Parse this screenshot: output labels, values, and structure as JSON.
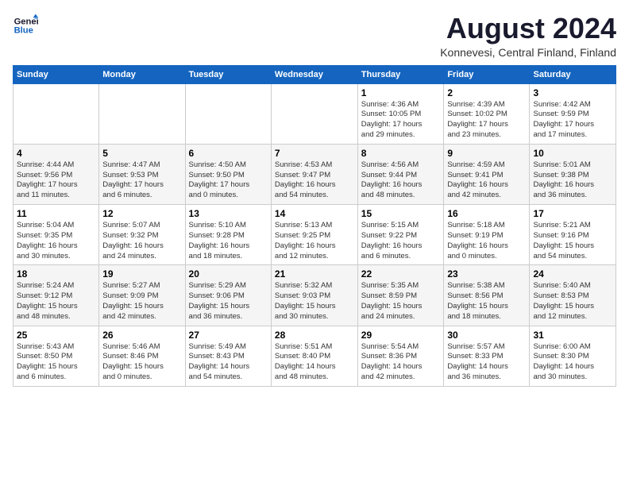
{
  "header": {
    "logo_line1": "General",
    "logo_line2": "Blue",
    "month_title": "August 2024",
    "location": "Konnevesi, Central Finland, Finland"
  },
  "weekdays": [
    "Sunday",
    "Monday",
    "Tuesday",
    "Wednesday",
    "Thursday",
    "Friday",
    "Saturday"
  ],
  "weeks": [
    [
      {
        "day": "",
        "info": ""
      },
      {
        "day": "",
        "info": ""
      },
      {
        "day": "",
        "info": ""
      },
      {
        "day": "",
        "info": ""
      },
      {
        "day": "1",
        "info": "Sunrise: 4:36 AM\nSunset: 10:05 PM\nDaylight: 17 hours\nand 29 minutes."
      },
      {
        "day": "2",
        "info": "Sunrise: 4:39 AM\nSunset: 10:02 PM\nDaylight: 17 hours\nand 23 minutes."
      },
      {
        "day": "3",
        "info": "Sunrise: 4:42 AM\nSunset: 9:59 PM\nDaylight: 17 hours\nand 17 minutes."
      }
    ],
    [
      {
        "day": "4",
        "info": "Sunrise: 4:44 AM\nSunset: 9:56 PM\nDaylight: 17 hours\nand 11 minutes."
      },
      {
        "day": "5",
        "info": "Sunrise: 4:47 AM\nSunset: 9:53 PM\nDaylight: 17 hours\nand 6 minutes."
      },
      {
        "day": "6",
        "info": "Sunrise: 4:50 AM\nSunset: 9:50 PM\nDaylight: 17 hours\nand 0 minutes."
      },
      {
        "day": "7",
        "info": "Sunrise: 4:53 AM\nSunset: 9:47 PM\nDaylight: 16 hours\nand 54 minutes."
      },
      {
        "day": "8",
        "info": "Sunrise: 4:56 AM\nSunset: 9:44 PM\nDaylight: 16 hours\nand 48 minutes."
      },
      {
        "day": "9",
        "info": "Sunrise: 4:59 AM\nSunset: 9:41 PM\nDaylight: 16 hours\nand 42 minutes."
      },
      {
        "day": "10",
        "info": "Sunrise: 5:01 AM\nSunset: 9:38 PM\nDaylight: 16 hours\nand 36 minutes."
      }
    ],
    [
      {
        "day": "11",
        "info": "Sunrise: 5:04 AM\nSunset: 9:35 PM\nDaylight: 16 hours\nand 30 minutes."
      },
      {
        "day": "12",
        "info": "Sunrise: 5:07 AM\nSunset: 9:32 PM\nDaylight: 16 hours\nand 24 minutes."
      },
      {
        "day": "13",
        "info": "Sunrise: 5:10 AM\nSunset: 9:28 PM\nDaylight: 16 hours\nand 18 minutes."
      },
      {
        "day": "14",
        "info": "Sunrise: 5:13 AM\nSunset: 9:25 PM\nDaylight: 16 hours\nand 12 minutes."
      },
      {
        "day": "15",
        "info": "Sunrise: 5:15 AM\nSunset: 9:22 PM\nDaylight: 16 hours\nand 6 minutes."
      },
      {
        "day": "16",
        "info": "Sunrise: 5:18 AM\nSunset: 9:19 PM\nDaylight: 16 hours\nand 0 minutes."
      },
      {
        "day": "17",
        "info": "Sunrise: 5:21 AM\nSunset: 9:16 PM\nDaylight: 15 hours\nand 54 minutes."
      }
    ],
    [
      {
        "day": "18",
        "info": "Sunrise: 5:24 AM\nSunset: 9:12 PM\nDaylight: 15 hours\nand 48 minutes."
      },
      {
        "day": "19",
        "info": "Sunrise: 5:27 AM\nSunset: 9:09 PM\nDaylight: 15 hours\nand 42 minutes."
      },
      {
        "day": "20",
        "info": "Sunrise: 5:29 AM\nSunset: 9:06 PM\nDaylight: 15 hours\nand 36 minutes."
      },
      {
        "day": "21",
        "info": "Sunrise: 5:32 AM\nSunset: 9:03 PM\nDaylight: 15 hours\nand 30 minutes."
      },
      {
        "day": "22",
        "info": "Sunrise: 5:35 AM\nSunset: 8:59 PM\nDaylight: 15 hours\nand 24 minutes."
      },
      {
        "day": "23",
        "info": "Sunrise: 5:38 AM\nSunset: 8:56 PM\nDaylight: 15 hours\nand 18 minutes."
      },
      {
        "day": "24",
        "info": "Sunrise: 5:40 AM\nSunset: 8:53 PM\nDaylight: 15 hours\nand 12 minutes."
      }
    ],
    [
      {
        "day": "25",
        "info": "Sunrise: 5:43 AM\nSunset: 8:50 PM\nDaylight: 15 hours\nand 6 minutes."
      },
      {
        "day": "26",
        "info": "Sunrise: 5:46 AM\nSunset: 8:46 PM\nDaylight: 15 hours\nand 0 minutes."
      },
      {
        "day": "27",
        "info": "Sunrise: 5:49 AM\nSunset: 8:43 PM\nDaylight: 14 hours\nand 54 minutes."
      },
      {
        "day": "28",
        "info": "Sunrise: 5:51 AM\nSunset: 8:40 PM\nDaylight: 14 hours\nand 48 minutes."
      },
      {
        "day": "29",
        "info": "Sunrise: 5:54 AM\nSunset: 8:36 PM\nDaylight: 14 hours\nand 42 minutes."
      },
      {
        "day": "30",
        "info": "Sunrise: 5:57 AM\nSunset: 8:33 PM\nDaylight: 14 hours\nand 36 minutes."
      },
      {
        "day": "31",
        "info": "Sunrise: 6:00 AM\nSunset: 8:30 PM\nDaylight: 14 hours\nand 30 minutes."
      }
    ]
  ]
}
